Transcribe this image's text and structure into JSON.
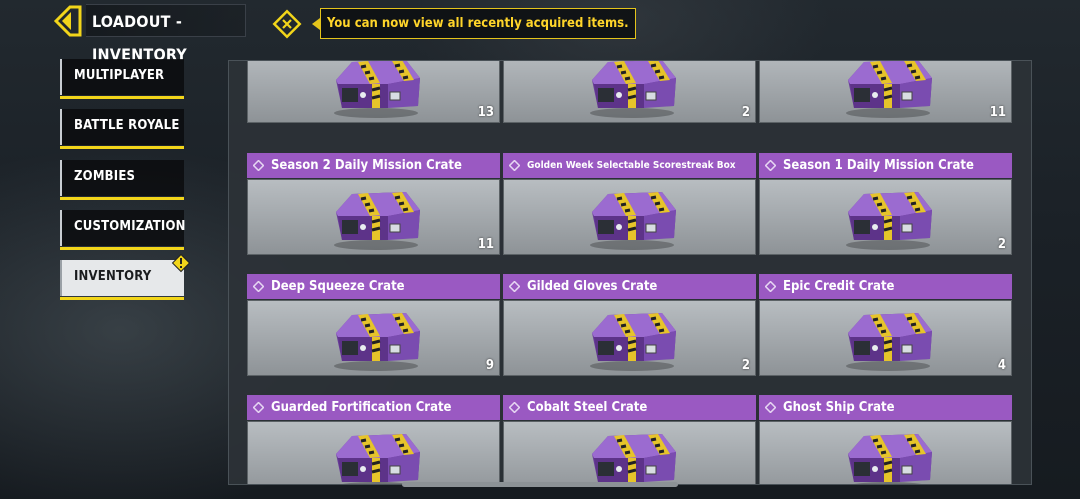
{
  "header": {
    "title": "LOADOUT - INVENTORY",
    "notification": "You can now view all recently acquired items."
  },
  "sidebar": {
    "items": [
      {
        "label": "MULTIPLAYER"
      },
      {
        "label": "BATTLE ROYALE"
      },
      {
        "label": "ZOMBIES"
      },
      {
        "label": "CUSTOMIZATION"
      },
      {
        "label": "INVENTORY",
        "active": true
      }
    ]
  },
  "grid": {
    "rows": [
      [
        {
          "title": "",
          "count": "13"
        },
        {
          "title": "",
          "count": "2"
        },
        {
          "title": "",
          "count": "11"
        }
      ],
      [
        {
          "title": "Season 2 Daily Mission Crate",
          "count": "11"
        },
        {
          "title": "Golden Week Selectable Scorestreak Box",
          "count": ""
        },
        {
          "title": "Season 1 Daily Mission Crate",
          "count": "2"
        }
      ],
      [
        {
          "title": "Deep Squeeze Crate",
          "count": "9"
        },
        {
          "title": "Gilded Gloves Crate",
          "count": "2"
        },
        {
          "title": "Epic Credit Crate",
          "count": "4"
        }
      ],
      [
        {
          "title": "Guarded Fortification Crate",
          "count": ""
        },
        {
          "title": "Cobalt Steel Crate",
          "count": ""
        },
        {
          "title": "Ghost Ship Crate",
          "count": ""
        }
      ]
    ]
  },
  "colors": {
    "accent_yellow": "#f2d51a",
    "title_purple": "#9a59c2",
    "crate_purple": "#7b4fb0"
  },
  "icons": [
    "back-arrow-icon",
    "notification-scan-icon",
    "alert-icon",
    "crate-icon",
    "diamond-icon"
  ]
}
